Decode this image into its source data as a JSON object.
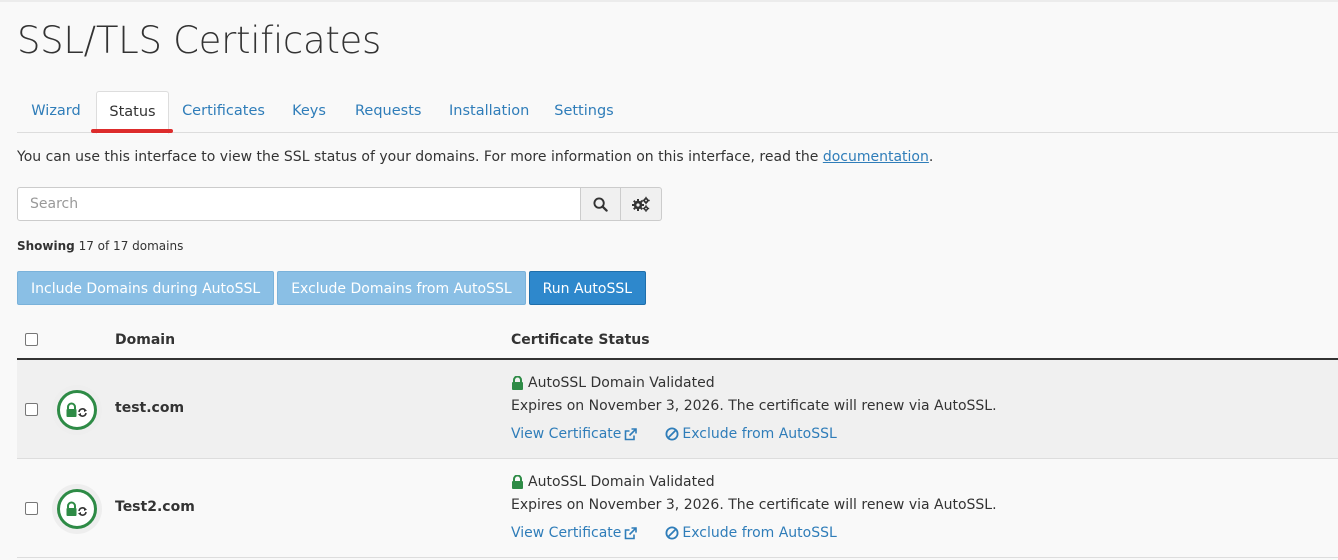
{
  "page": {
    "title": "SSL/TLS Certificates"
  },
  "tabs": [
    {
      "label": "Wizard"
    },
    {
      "label": "Status"
    },
    {
      "label": "Certificates"
    },
    {
      "label": "Keys"
    },
    {
      "label": "Requests"
    },
    {
      "label": "Installation"
    },
    {
      "label": "Settings"
    }
  ],
  "active_tab": "Status",
  "intro": {
    "text": "You can use this interface to view the SSL status of your domains. For more information on this interface, read the ",
    "link": "documentation",
    "suffix": "."
  },
  "search": {
    "placeholder": "Search",
    "value": ""
  },
  "icons": {
    "search": "search-icon",
    "settings": "gears-icon"
  },
  "showing": {
    "label": "Showing",
    "text": "17 of 17 domains"
  },
  "actions": {
    "include": "Include Domains during AutoSSL",
    "exclude": "Exclude Domains from AutoSSL",
    "run": "Run AutoSSL"
  },
  "table": {
    "headers": {
      "domain": "Domain",
      "status": "Certificate Status"
    },
    "rows": [
      {
        "domain": "test.com",
        "status": "AutoSSL Domain Validated",
        "expiry": "Expires on November 3, 2026. The certificate will renew via AutoSSL.",
        "view_link": "View Certificate",
        "exclude_link": "Exclude from AutoSSL"
      },
      {
        "domain": "Test2.com",
        "status": "AutoSSL Domain Validated",
        "expiry": "Expires on November 3, 2026. The certificate will renew via AutoSSL.",
        "view_link": "View Certificate",
        "exclude_link": "Exclude from AutoSSL"
      }
    ]
  },
  "colors": {
    "link": "#2f7db9",
    "active_tab_underline": "#dd2c2c",
    "status_green": "#2e8b46",
    "primary_button": "#2e88cc",
    "light_button": "#8abfe5"
  }
}
